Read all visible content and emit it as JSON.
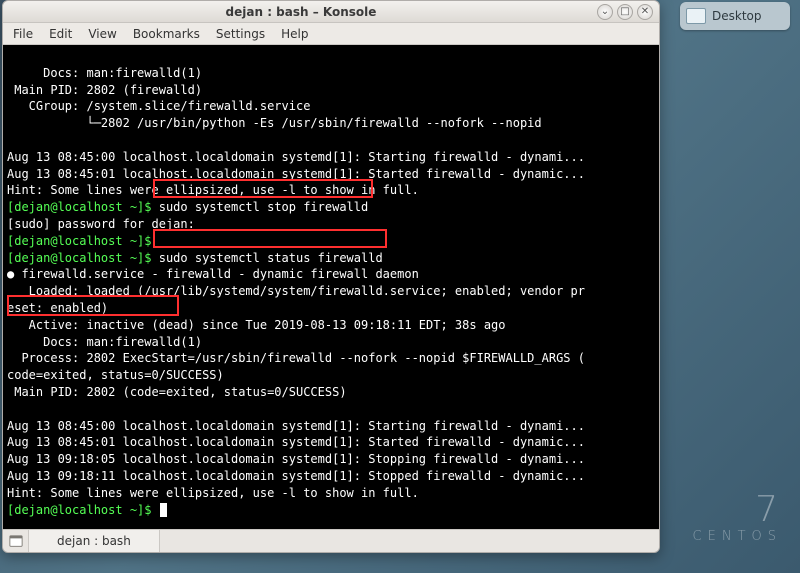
{
  "desktop": {
    "icon_label": "Desktop"
  },
  "centos": {
    "big": "7",
    "sub": "CENTOS"
  },
  "window": {
    "title": "dejan : bash – Konsole",
    "menu": {
      "file": "File",
      "edit": "Edit",
      "view": "View",
      "bookmarks": "Bookmarks",
      "settings": "Settings",
      "help": "Help"
    },
    "tab_label": "dejan : bash"
  },
  "term": {
    "l01": "     Docs: man:firewalld(1)",
    "l02": " Main PID: 2802 (firewalld)",
    "l03": "   CGroup: /system.slice/firewalld.service",
    "l04": "           └─2802 /usr/bin/python -Es /usr/sbin/firewalld --nofork --nopid",
    "l05": "",
    "l06": "Aug 13 08:45:00 localhost.localdomain systemd[1]: Starting firewalld - dynami...",
    "l07": "Aug 13 08:45:01 localhost.localdomain systemd[1]: Started firewalld - dynamic...",
    "l08": "Hint: Some lines were ellipsized, use -l to show in full.",
    "p1": "[dejan@localhost ~]$ ",
    "c1": "sudo systemctl stop firewalld",
    "l10": "[sudo] password for dejan: ",
    "p2": "[dejan@localhost ~]$ ",
    "p3": "[dejan@localhost ~]$ ",
    "c3": "sudo systemctl status firewalld",
    "l13a": "● firewalld.service - firewalld - dynamic firewall daemon",
    "l14": "   Loaded: loaded (/usr/lib/systemd/system/firewalld.service; enabled; vendor pr",
    "l15": "eset: enabled)",
    "l16": "   Active: inactive (dead) since Tue 2019-08-13 09:18:11 EDT; 38s ago",
    "l17": "     Docs: man:firewalld(1)",
    "l18": "  Process: 2802 ExecStart=/usr/sbin/firewalld --nofork --nopid $FIREWALLD_ARGS (",
    "l19": "code=exited, status=0/SUCCESS)",
    "l20": " Main PID: 2802 (code=exited, status=0/SUCCESS)",
    "l21": "",
    "l22": "Aug 13 08:45:00 localhost.localdomain systemd[1]: Starting firewalld - dynami...",
    "l23": "Aug 13 08:45:01 localhost.localdomain systemd[1]: Started firewalld - dynamic...",
    "l24": "Aug 13 09:18:05 localhost.localdomain systemd[1]: Stopping firewalld - dynami...",
    "l25": "Aug 13 09:18:11 localhost.localdomain systemd[1]: Stopped firewalld - dynamic...",
    "l26": "Hint: Some lines were ellipsized, use -l to show in full.",
    "p4": "[dejan@localhost ~]$ "
  }
}
